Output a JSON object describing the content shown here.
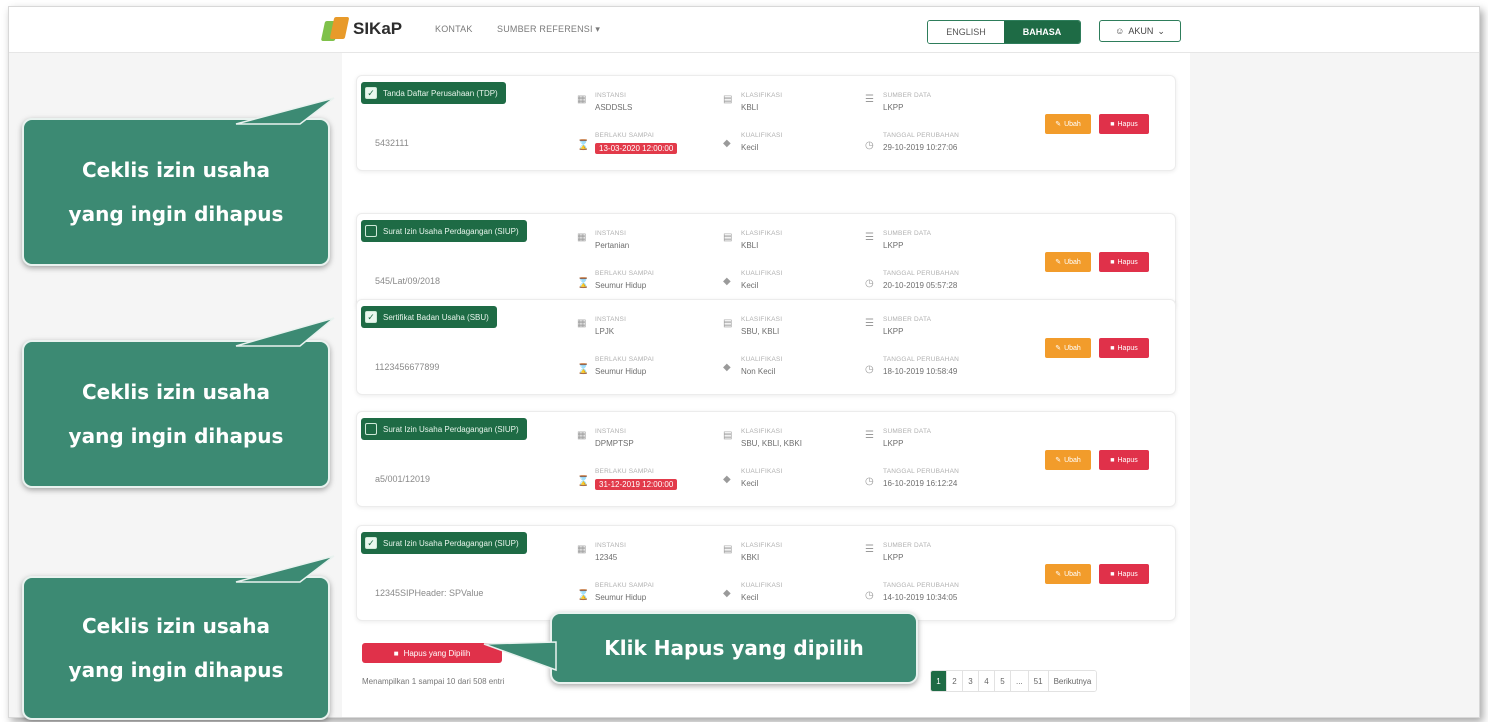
{
  "header": {
    "brand": "SIKaP",
    "nav": [
      "KONTAK",
      "SUMBER REFERENSI ▾"
    ],
    "lang_en": "ENGLISH",
    "lang_id": "BAHASA",
    "account": "AKUN"
  },
  "labels": {
    "instansi": "INSTANSI",
    "klasifikasi": "KLASIFIKASI",
    "sumber_data": "SUMBER DATA",
    "berlaku": "BERLAKU SAMPAI",
    "kualifikasi": "KUALIFIKASI",
    "tanggal": "TANGGAL PERUBAHAN",
    "ubah": "Ubah",
    "hapus": "Hapus"
  },
  "cards": [
    {
      "name": "Tanda Daftar Perusahaan (TDP)",
      "checked": true,
      "regno": "5432111",
      "instansi": "ASDDSLS",
      "klasifikasi": "KBLI",
      "sumber": "LKPP",
      "berlaku": "13-03-2020 12:00:00",
      "berlaku_red": true,
      "kualifikasi": "Kecil",
      "tanggal": "29-10-2019 10:27:06"
    },
    {
      "name": "Surat Izin Usaha Perdagangan (SIUP)",
      "checked": false,
      "regno": "545/Lat/09/2018",
      "instansi": "Pertanian",
      "klasifikasi": "KBLI",
      "sumber": "LKPP",
      "berlaku": "Seumur Hidup",
      "berlaku_red": false,
      "kualifikasi": "Kecil",
      "tanggal": "20-10-2019 05:57:28"
    },
    {
      "name": "Sertifikat Badan Usaha (SBU)",
      "checked": true,
      "regno": "1123456677899",
      "instansi": "LPJK",
      "klasifikasi": "SBU, KBLI",
      "sumber": "LKPP",
      "berlaku": "Seumur Hidup",
      "berlaku_red": false,
      "kualifikasi": "Non Kecil",
      "tanggal": "18-10-2019 10:58:49"
    },
    {
      "name": "Surat Izin Usaha Perdagangan (SIUP)",
      "checked": false,
      "regno": "a5/001/12019",
      "instansi": "DPMPTSP",
      "klasifikasi": "SBU, KBLI, KBKI",
      "sumber": "LKPP",
      "berlaku": "31-12-2019 12:00:00",
      "berlaku_red": true,
      "kualifikasi": "Kecil",
      "tanggal": "16-10-2019 16:12:24"
    },
    {
      "name": "Surat Izin Usaha Perdagangan (SIUP)",
      "checked": true,
      "regno": "12345SIPHeader: SPValue",
      "instansi": "12345",
      "klasifikasi": "KBKI",
      "sumber": "LKPP",
      "berlaku": "Seumur Hidup",
      "berlaku_red": false,
      "kualifikasi": "Kecil",
      "tanggal": "14-10-2019 10:34:05"
    }
  ],
  "footer": {
    "delete_selected": "Hapus yang Dipilih",
    "showing": "Menampilkan 1 sampai 10 dari 508 entri",
    "pages": [
      "1",
      "2",
      "3",
      "4",
      "5",
      "...",
      "51",
      "Berikutnya"
    ]
  },
  "callouts": {
    "c1": [
      "Ceklis izin usaha",
      "yang ingin dihapus"
    ],
    "c2": [
      "Ceklis izin usaha",
      "yang ingin dihapus"
    ],
    "c3": [
      "Ceklis izin usaha",
      "yang ingin dihapus"
    ],
    "c4": "Klik Hapus yang dipilih"
  },
  "colors": {
    "primary": "#1e6b45",
    "danger": "#e0314a",
    "warning": "#f29c2b",
    "callout": "#3c8a73"
  }
}
